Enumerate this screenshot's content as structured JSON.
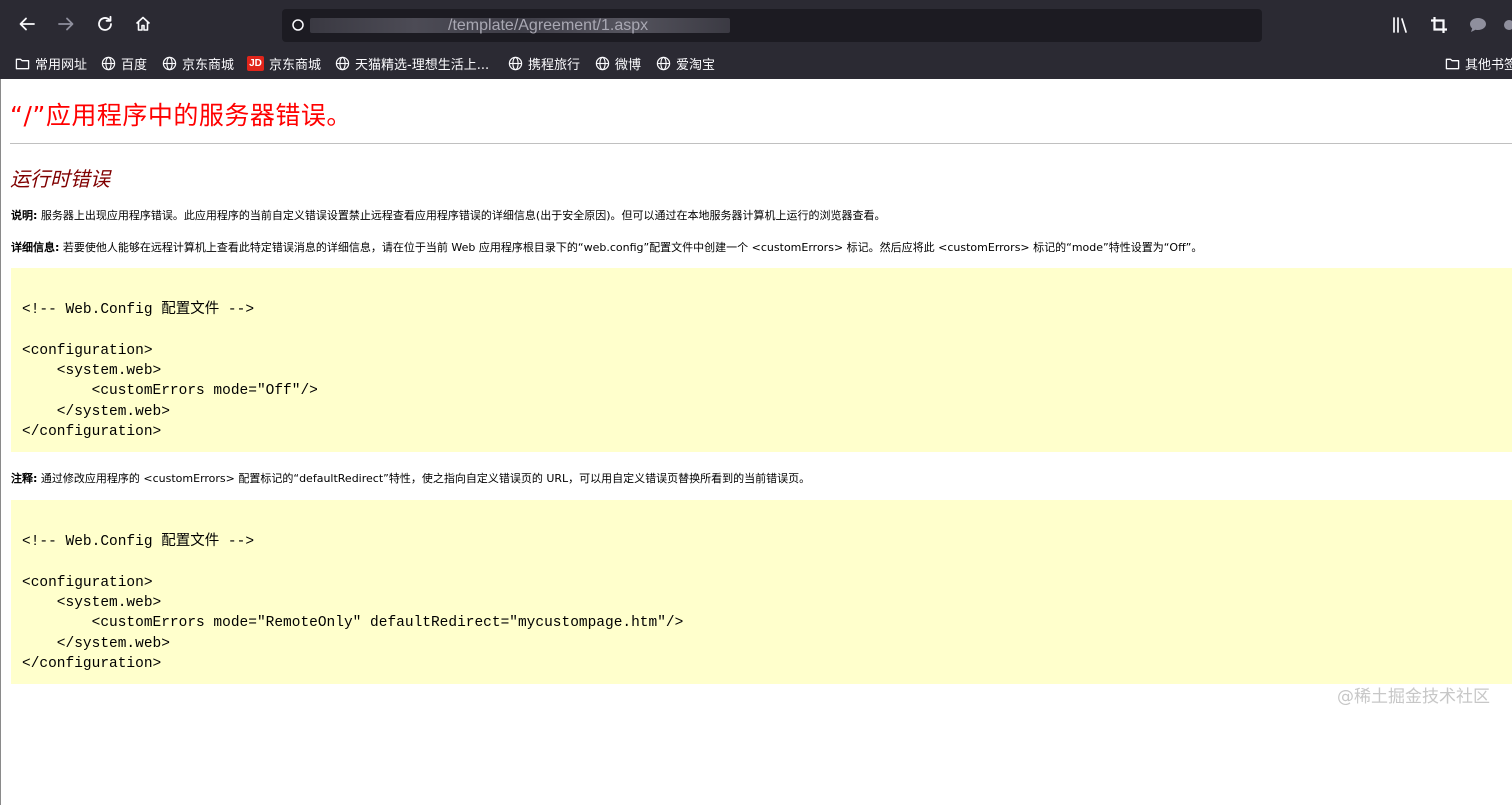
{
  "browser": {
    "url_visible": "/template/Agreement/1.aspx",
    "bookmarks": [
      {
        "label": "常用网址",
        "icon": "folder-icon"
      },
      {
        "label": "百度",
        "icon": "globe-icon"
      },
      {
        "label": "京东商城",
        "icon": "globe-icon"
      },
      {
        "label": "京东商城",
        "icon": "jd-icon"
      },
      {
        "label": "天猫精选-理想生活上...",
        "icon": "globe-icon"
      },
      {
        "label": "携程旅行",
        "icon": "globe-icon"
      },
      {
        "label": "微博",
        "icon": "globe-icon"
      },
      {
        "label": "爱淘宝",
        "icon": "globe-icon"
      }
    ],
    "other_bookmarks": "其他书签",
    "jd_logo_text": "JD",
    "colors": {
      "toolbar_bg": "#2b2a33",
      "icon": "#fbfbfe",
      "disabled_icon": "#8f8f9d"
    }
  },
  "page": {
    "title": "“/”应用程序中的服务器错误。",
    "subtitle": "运行时错误",
    "description_label": "说明:",
    "description_text": " 服务器上出现应用程序错误。此应用程序的当前自定义错误设置禁止远程查看应用程序错误的详细信息(出于安全原因)。但可以通过在本地服务器计算机上运行的浏览器查看。",
    "details_label": "详细信息:",
    "details_text": " 若要使他人能够在远程计算机上查看此特定错误消息的详细信息，请在位于当前 Web 应用程序根目录下的“web.config”配置文件中创建一个 <customErrors> 标记。然后应将此 <customErrors> 标记的“mode”特性设置为“Off”。",
    "code1": "\n<!-- Web.Config 配置文件 -->\n\n<configuration>\n    <system.web>\n        <customErrors mode=\"Off\"/>\n    </system.web>\n</configuration>",
    "notes_label": "注释:",
    "notes_text": " 通过修改应用程序的 <customErrors> 配置标记的“defaultRedirect”特性，使之指向自定义错误页的 URL，可以用自定义错误页替换所看到的当前错误页。",
    "code2": "\n<!-- Web.Config 配置文件 -->\n\n<configuration>\n    <system.web>\n        <customErrors mode=\"RemoteOnly\" defaultRedirect=\"mycustompage.htm\"/>\n    </system.web>\n</configuration>",
    "colors": {
      "title": "#ff0000",
      "subtitle": "#800000",
      "code_bg": "#ffffcc"
    }
  },
  "watermark": "@稀土掘金技术社区"
}
